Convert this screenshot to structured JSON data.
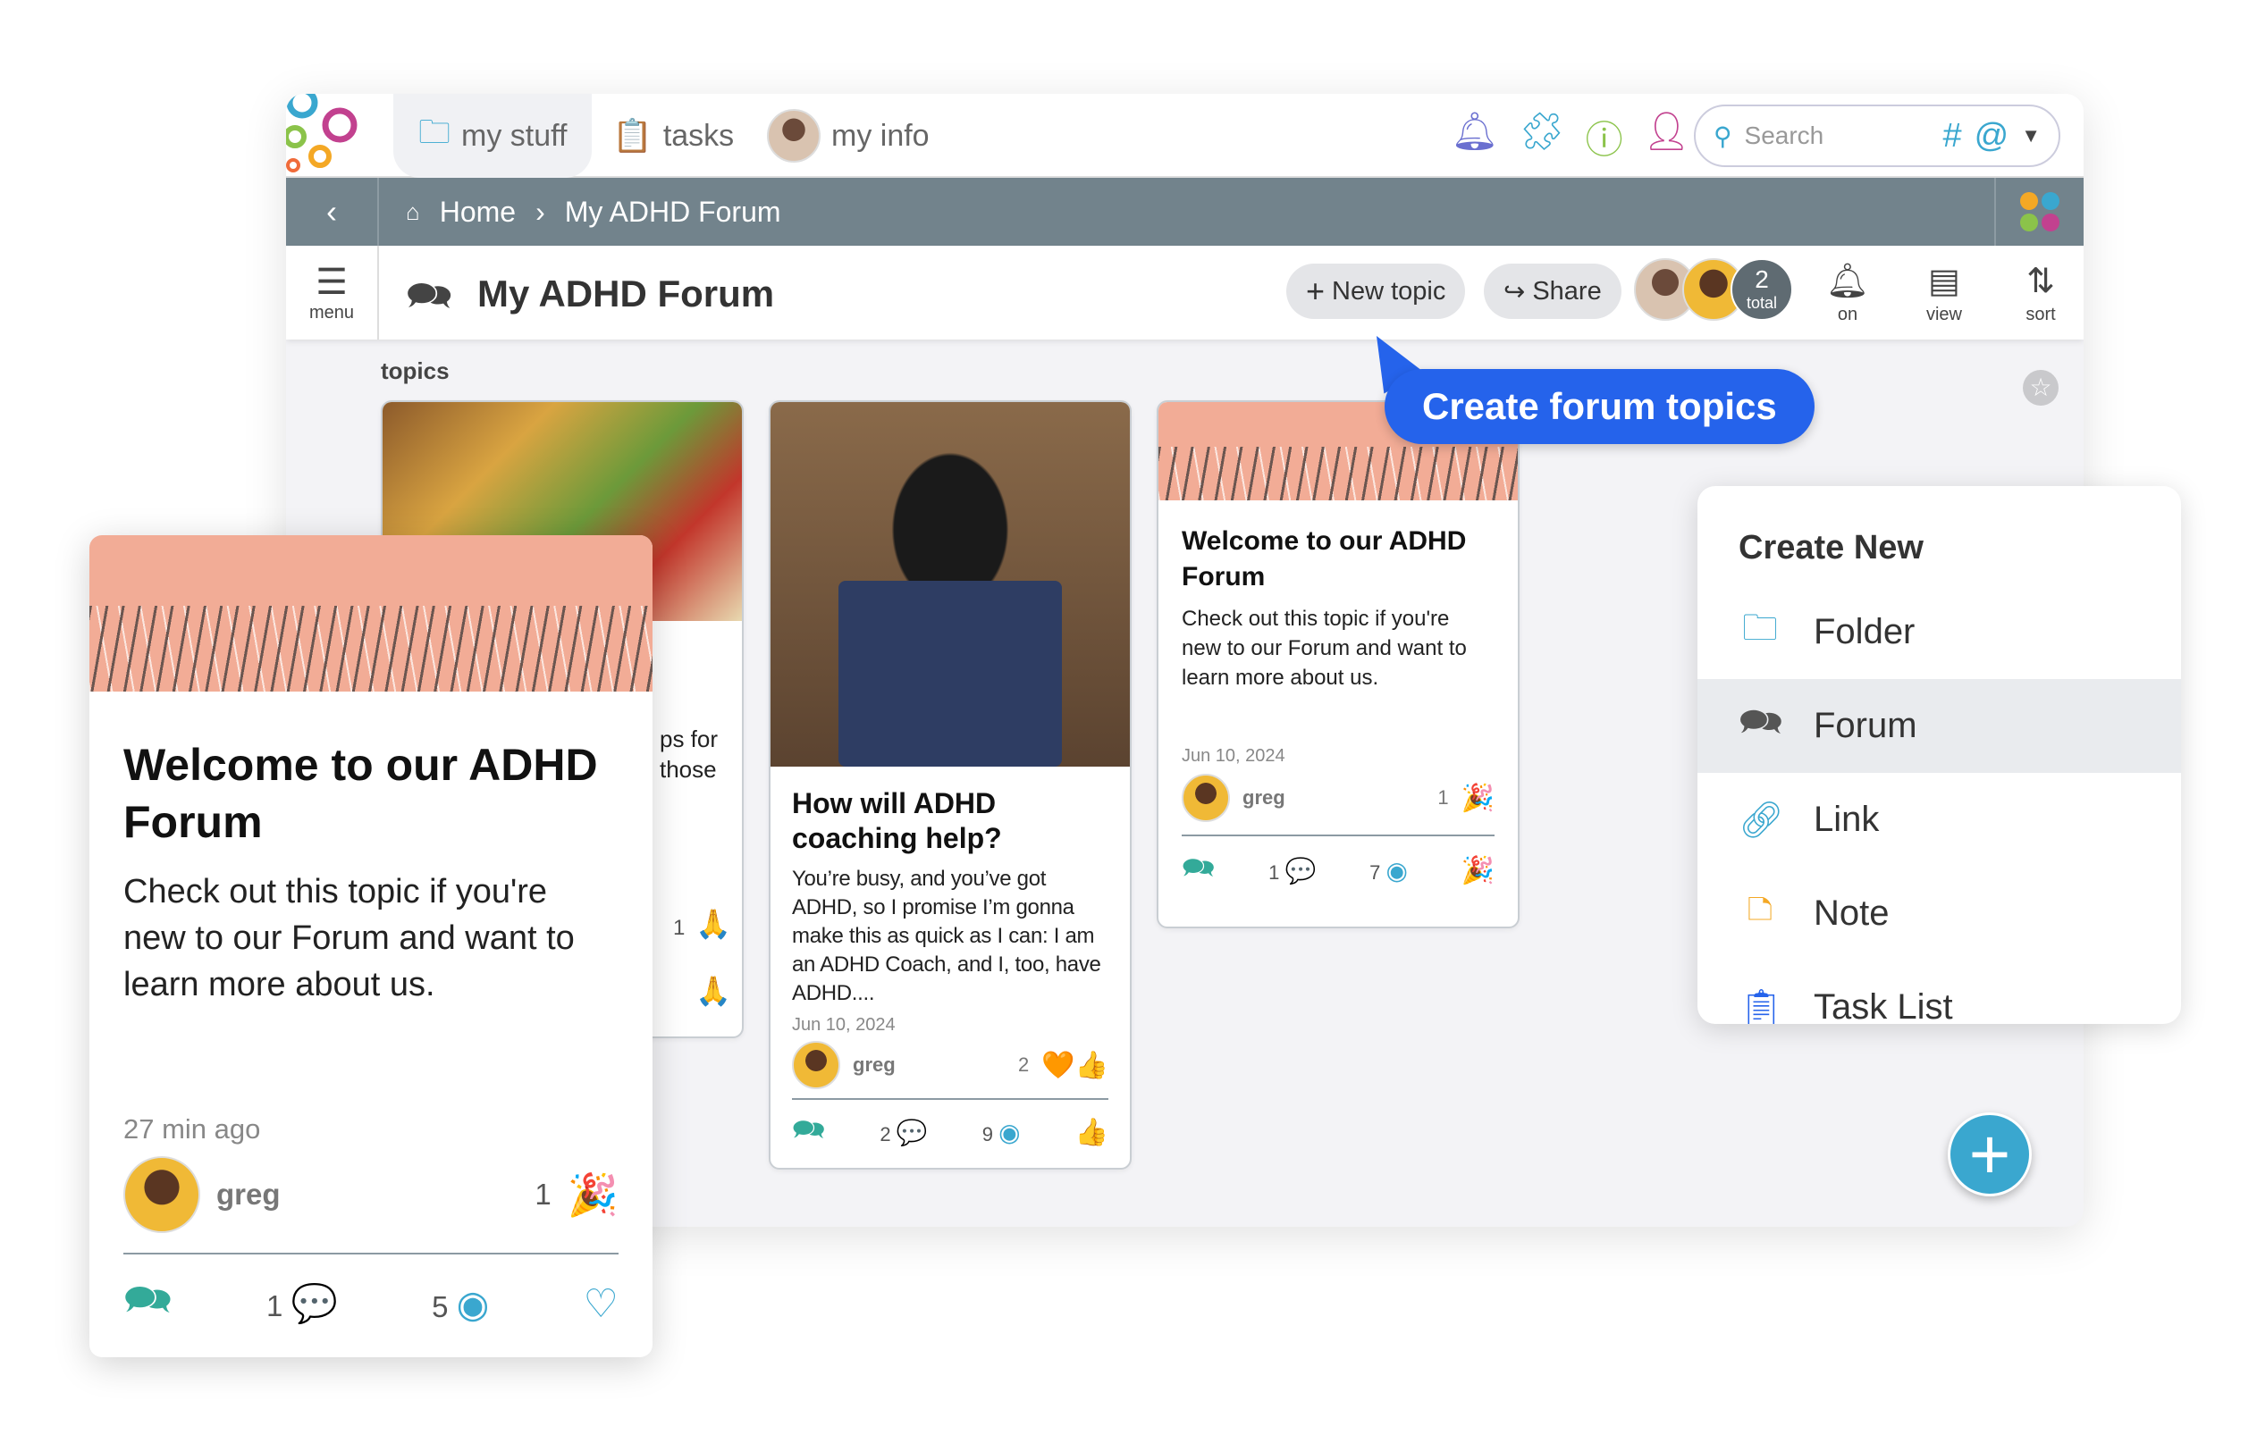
{
  "topbar": {
    "tabs": [
      {
        "label": "my stuff",
        "icon": "folder-icon"
      },
      {
        "label": "tasks",
        "icon": "clipboard-check-icon"
      },
      {
        "label": "my info",
        "icon": "avatar"
      }
    ],
    "icons": [
      "bell-icon",
      "puzzle-icon",
      "help-icon",
      "add-user-icon"
    ],
    "search": {
      "placeholder": "Search",
      "hash": "#",
      "at": "@"
    }
  },
  "breadcrumb": {
    "items": [
      "Home",
      "My ADHD Forum"
    ]
  },
  "header": {
    "title": "My ADHD Forum",
    "new_topic": "New topic",
    "share": "Share",
    "members_count": "2",
    "members_label": "total",
    "tools": [
      {
        "label": "on",
        "icon": "bell-icon"
      },
      {
        "label": "view",
        "icon": "layout-icon"
      },
      {
        "label": "sort",
        "icon": "sort-icon"
      }
    ],
    "menu_label": "menu"
  },
  "section_label": "topics",
  "cards": [
    {
      "partial_text": [
        "ps for",
        "those"
      ],
      "reaction_count": "1"
    },
    {
      "title": "How will ADHD coaching help?",
      "body": "You’re busy, and you’ve got ADHD, so I promise I’m gonna make this as quick as I can: I am an ADHD Coach, and I, too, have ADHD....",
      "date": "Jun 10, 2024",
      "author": "greg",
      "reactions": "2",
      "comments": "2",
      "views": "9"
    },
    {
      "title": "Welcome to our ADHD Forum",
      "body": "Check out this topic if you're new to our Forum and want to learn more about us.",
      "date": "Jun 10, 2024",
      "author": "greg",
      "reactions": "1",
      "comments": "1",
      "views": "7"
    }
  ],
  "featured_card": {
    "title": "Welcome to our ADHD Forum",
    "body": "Check out this topic if you're new to our Forum and want to learn more about us.",
    "time": "27 min ago",
    "author": "greg",
    "reactions": "1",
    "comments": "1",
    "views": "5"
  },
  "tooltip": "Create forum topics",
  "create_new": {
    "title": "Create New",
    "items": [
      {
        "label": "Folder",
        "icon": "folder-icon"
      },
      {
        "label": "Forum",
        "icon": "forum-icon",
        "selected": true
      },
      {
        "label": "Link",
        "icon": "link-icon"
      },
      {
        "label": "Note",
        "icon": "note-icon"
      },
      {
        "label": "Task List",
        "icon": "clipboard-icon"
      }
    ]
  },
  "colors": {
    "accent": "#3aa7cf",
    "tooltip": "#2563eb",
    "breadcrumb_bar": "#72838c"
  }
}
